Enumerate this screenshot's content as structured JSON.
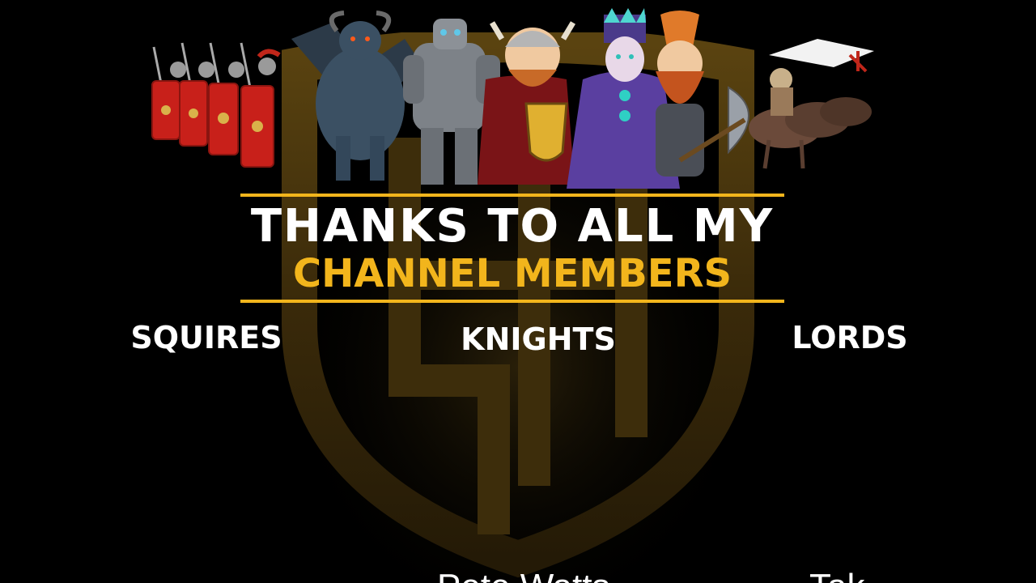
{
  "title": {
    "line1": "THANKS TO ALL MY",
    "line2": "CHANNEL MEMBERS"
  },
  "tiers": {
    "squires": {
      "label": "SQUIRES"
    },
    "knights": {
      "label": "KNIGHTS",
      "members": [
        "Pete Watts"
      ]
    },
    "lords": {
      "label": "LORDS",
      "members": [
        "Tak"
      ]
    }
  },
  "colors": {
    "background": "#000000",
    "accent": "#f2b51c",
    "text": "#ffffff"
  },
  "icons": {
    "emblem": "shield-emblem-icon",
    "banner": "fantasy-characters-banner"
  }
}
